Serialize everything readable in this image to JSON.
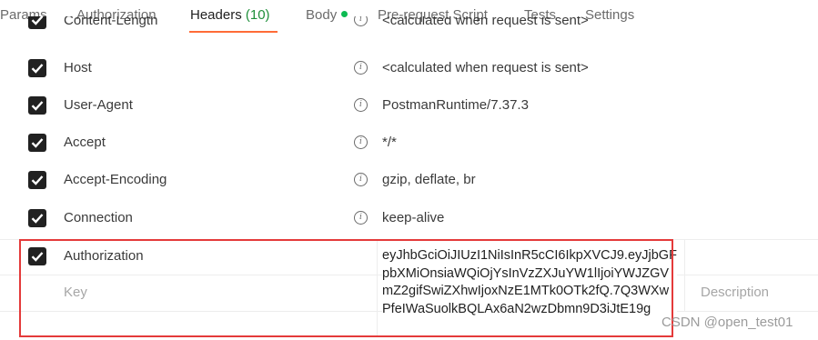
{
  "tabs": [
    {
      "label": "Params"
    },
    {
      "label": "Authorization"
    },
    {
      "label": "Headers",
      "count": "(10)"
    },
    {
      "label": "Body"
    },
    {
      "label": "Pre-request Script"
    },
    {
      "label": "Tests"
    },
    {
      "label": "Settings"
    }
  ],
  "active_tab": "Headers",
  "headers": {
    "partial": {
      "key": "Content-Length",
      "value": "<calculated when request is sent>"
    },
    "rows": [
      {
        "key": "Host",
        "value": "<calculated when request is sent>",
        "checked": true
      },
      {
        "key": "User-Agent",
        "value": "PostmanRuntime/7.37.3",
        "checked": true
      },
      {
        "key": "Accept",
        "value": "*/*",
        "checked": true
      },
      {
        "key": "Accept-Encoding",
        "value": "gzip, deflate, br",
        "checked": true
      },
      {
        "key": "Connection",
        "value": "keep-alive",
        "checked": true
      },
      {
        "key": "Authorization",
        "value": "eyJhbGciOiJIUzI1NiIsInR5cCI6IkpXVCJ9.eyJjbGFpbXMiOnsiaWQiOjYsInVzZXJuYW1lIjoiYWJZGVmZ2gifSwiZXhwIjoxNzE1MTk0OTk2fQ.7Q3WXwPfeIWaSuolkBQLAx6aN2wzDbmn9D3iJtE19g",
        "checked": true
      }
    ]
  },
  "new_row": {
    "key_placeholder": "Key",
    "description_placeholder": "Description"
  },
  "watermark": "CSDN @open_test01",
  "colors": {
    "accent_underline": "#ff6c37",
    "body_dot": "#0cbb52",
    "highlight_box": "#e43a3a"
  }
}
